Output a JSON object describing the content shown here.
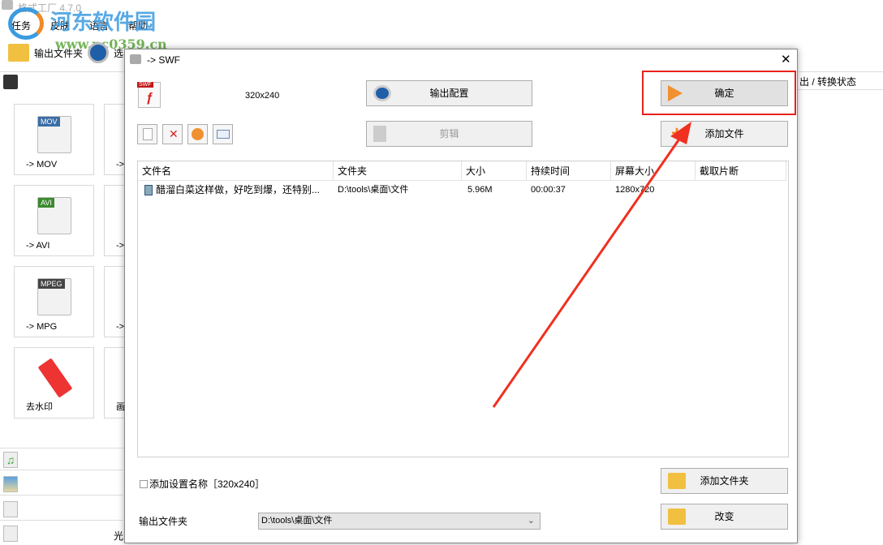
{
  "app": {
    "title": "格式工厂 4.7.0",
    "menu": [
      "任务",
      "皮肤",
      "语言",
      "帮助"
    ],
    "toolbar": {
      "output_folder": "输出文件夹",
      "options": "选"
    },
    "right_header": "出 / 转换状态",
    "tiles": [
      {
        "tag": "MOV",
        "label": "-> MOV"
      },
      {
        "tag": "AVI",
        "label": "-> AVI"
      },
      {
        "tag": "MPEG",
        "label": "-> MPG"
      },
      {
        "tag": "",
        "label": "去水印"
      }
    ],
    "tiles_col2": [
      "->",
      "->",
      "->",
      "画"
    ],
    "side_rows": [
      {
        "icon": "music-icon",
        "label": ""
      },
      {
        "icon": "image-icon",
        "label": ""
      },
      {
        "icon": "document-icon",
        "label": ""
      },
      {
        "icon": "disc-icon",
        "label": "光"
      }
    ]
  },
  "watermark": {
    "name": "河东软件园",
    "url": "www.pc0359.cn"
  },
  "dialog": {
    "title": "-> SWF",
    "preset": "320x240",
    "output_config": "输出配置",
    "clip": "剪辑",
    "ok": "确定",
    "add_file": "添加文件",
    "add_folder": "添加文件夹",
    "change": "改变",
    "table": {
      "headers": [
        "文件名",
        "文件夹",
        "大小",
        "持续时间",
        "屏幕大小",
        "截取片断"
      ],
      "rows": [
        {
          "name": "醋溜白菜这样做，好吃到爆，还特别...",
          "folder": "D:\\tools\\桌面\\文件",
          "size": "5.96M",
          "duration": "00:00:37",
          "screen": "1280x720",
          "clip": ""
        }
      ]
    },
    "add_setting_name": "添加设置名称［320x240］",
    "output_folder_label": "输出文件夹",
    "output_folder_value": "D:\\tools\\桌面\\文件"
  },
  "colors": {
    "highlight": "#e8221a",
    "arrow": "#f03020"
  }
}
